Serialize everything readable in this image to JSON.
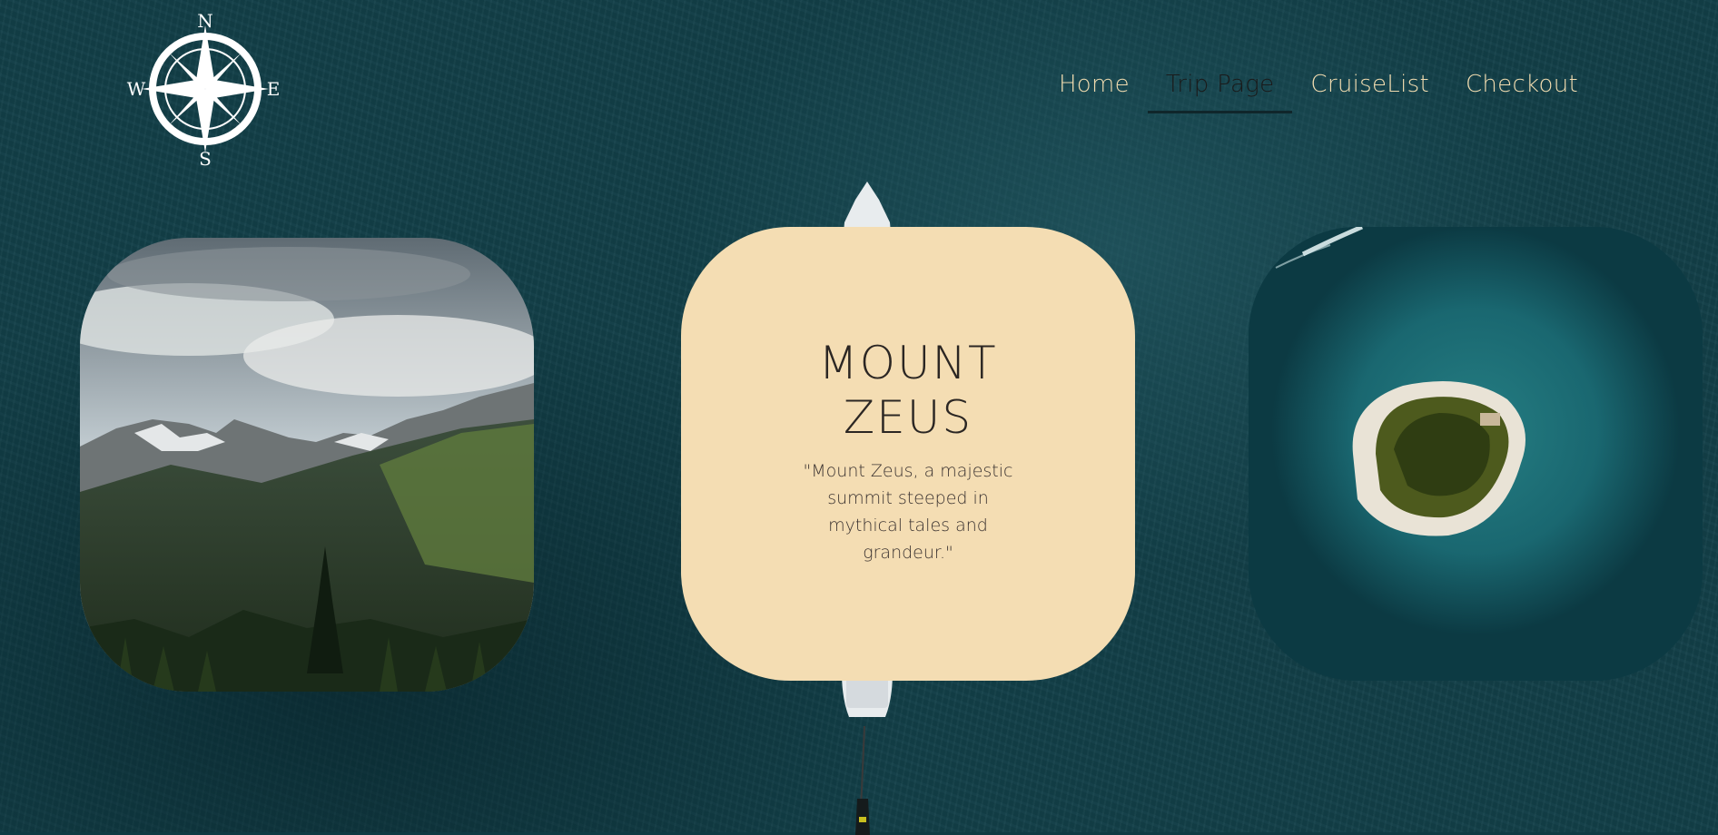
{
  "logo": {
    "alt": "Compass logo",
    "directions": {
      "north": "N",
      "south": "S",
      "east": "E",
      "west": "W"
    }
  },
  "nav": {
    "items": [
      {
        "label": "Home"
      },
      {
        "label": "Trip Page"
      },
      {
        "label": "CruiseList"
      },
      {
        "label": "Checkout"
      }
    ],
    "active_index": 1
  },
  "cards": {
    "left_image": "mountain-landscape-photo",
    "info": {
      "title": "MOUNT\nZEUS",
      "description": "\"Mount Zeus, a majestic summit steeped in mythical tales and grandeur.\""
    },
    "right_image": "island-aerial-photo"
  },
  "colors": {
    "ocean": "#123f48",
    "nav_text": "#f1dcb0",
    "nav_active": "#1a1a1a",
    "card_bg": "#f4ddb3",
    "card_text": "#2b2623"
  }
}
